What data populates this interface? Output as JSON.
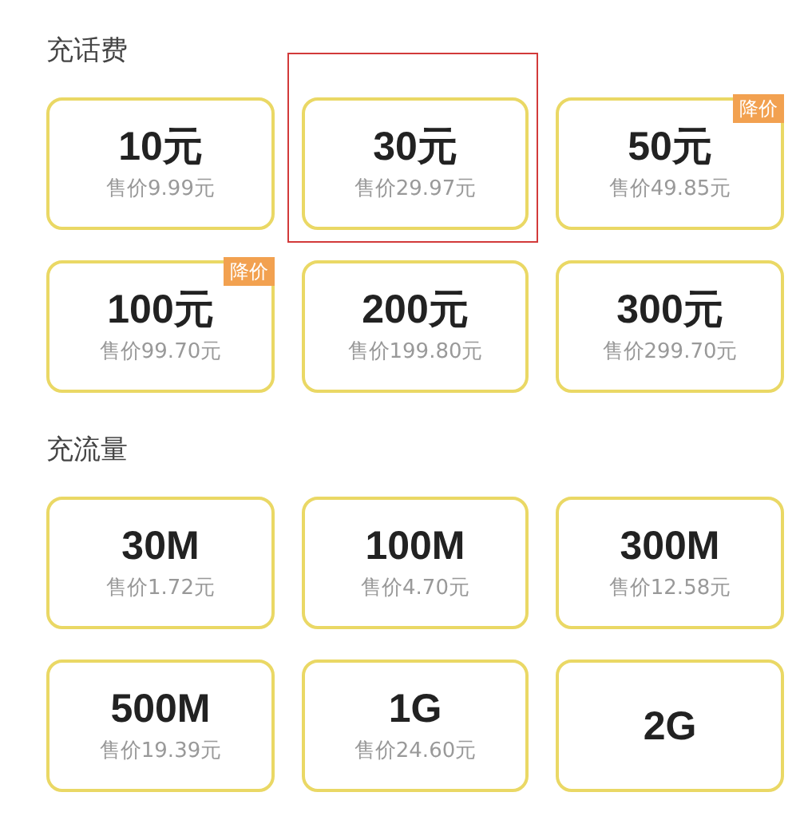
{
  "sections": [
    {
      "title": "充话费",
      "items": [
        {
          "amount": "10元",
          "price": "售价9.99元",
          "highlighted": false
        },
        {
          "amount": "30元",
          "price": "售价29.97元",
          "highlighted": true
        },
        {
          "amount": "50元",
          "price": "售价49.85元",
          "badge": "降价",
          "highlighted": false
        },
        {
          "amount": "100元",
          "price": "售价99.70元",
          "badge": "降价",
          "highlighted": false
        },
        {
          "amount": "200元",
          "price": "售价199.80元",
          "highlighted": false
        },
        {
          "amount": "300元",
          "price": "售价299.70元",
          "highlighted": false
        }
      ]
    },
    {
      "title": "充流量",
      "items": [
        {
          "amount": "30M",
          "price": "售价1.72元",
          "highlighted": false
        },
        {
          "amount": "100M",
          "price": "售价4.70元",
          "highlighted": false
        },
        {
          "amount": "300M",
          "price": "售价12.58元",
          "highlighted": false
        },
        {
          "amount": "500M",
          "price": "售价19.39元",
          "highlighted": false
        },
        {
          "amount": "1G",
          "price": "售价24.60元",
          "highlighted": false
        },
        {
          "amount": "2G",
          "highlighted": false
        }
      ]
    }
  ]
}
